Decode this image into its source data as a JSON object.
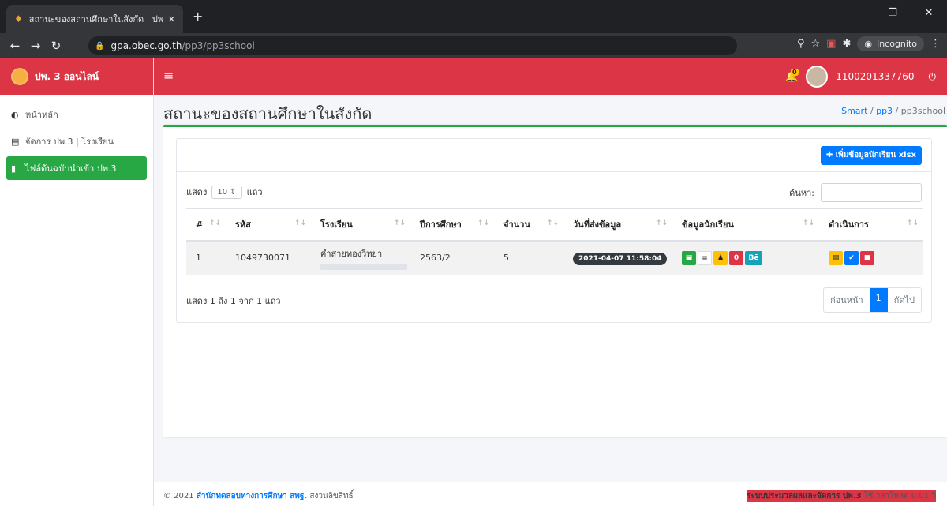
{
  "browser": {
    "tab_title": "สถานะของสถานศึกษาในสังกัด | ปพ. 3",
    "url_host": "gpa.obec.go.th",
    "url_path": "/pp3/pp3school",
    "incognito_label": "Incognito"
  },
  "app": {
    "brand": "ปพ. 3 ออนไลน์",
    "user_id": "1100201337760",
    "notification_count": "0"
  },
  "sidebar": {
    "items": [
      {
        "label": "หน้าหลัก",
        "icon": "circle-half-icon"
      },
      {
        "label": "จัดการ ปพ.3 | โรงเรียน",
        "icon": "clipboard-icon"
      },
      {
        "label": "ไฟล์ต้นฉบับนำเข้า ปพ.3",
        "icon": "file-icon"
      }
    ]
  },
  "page": {
    "title": "สถานะของสถานศึกษาในสังกัด",
    "breadcrumb": [
      "Smart",
      "pp3",
      "pp3school"
    ]
  },
  "card": {
    "add_button": "เพิ่มข้อมูลนักเรียน xlsx",
    "length_prefix": "แสดง",
    "length_value": "10",
    "length_suffix": "แถว",
    "search_label": "ค้นหา:",
    "columns": [
      "#",
      "รหัส",
      "โรงเรียน",
      "ปีการศึกษา",
      "จำนวน",
      "วันที่ส่งข้อมูล",
      "ข้อมูลนักเรียน",
      "ดำเนินการ"
    ],
    "rows": [
      {
        "num": "1",
        "code": "1049730071",
        "school": "คำสายทองวิทยา",
        "year": "2563/2",
        "count": "5",
        "date": "2021-04-07 11:58:04"
      }
    ],
    "student_buttons": [
      "",
      "",
      "",
      "0",
      "Bē"
    ],
    "info": "แสดง 1 ถึง 1 จาก 1 แถว",
    "pager": {
      "prev": "ก่อนหน้า",
      "current": "1",
      "next": "ถัดไป"
    }
  },
  "footer": {
    "left_prefix": "© 2021",
    "left_org": "สำนักทดสอบทางการศึกษา สพฐ.",
    "left_suffix": "สงวนลิขสิทธิ์",
    "right_system": "ระบบประมวลผลและจัดการ ปพ.3",
    "right_load": "ใช้เวลาโหลด 0.01 วิ"
  }
}
